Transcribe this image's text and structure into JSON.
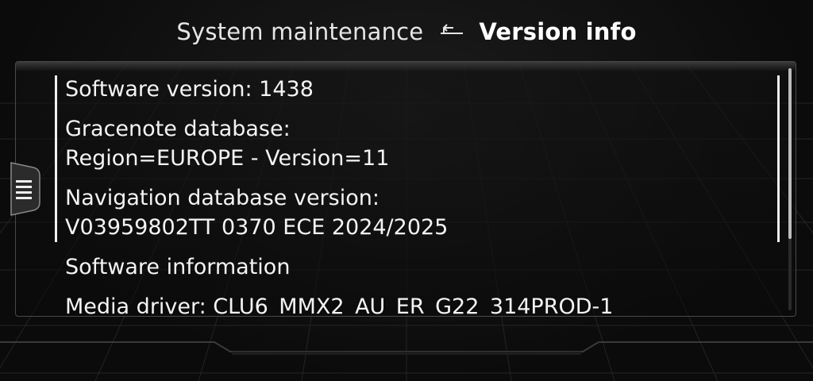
{
  "header": {
    "parent": "System maintenance",
    "current": "Version info",
    "back_icon": "return-arrow-icon"
  },
  "items": [
    {
      "lines": [
        "Software version: 1438"
      ]
    },
    {
      "lines": [
        "Gracenote database:",
        "Region=EUROPE - Version=11"
      ]
    },
    {
      "lines": [
        "Navigation database version:",
        "V03959802TT 0370 ECE 2024/2025"
      ]
    },
    {
      "lines": [
        "Software information"
      ]
    },
    {
      "lines": [
        "Media driver: CLU6_MMX2_AU_ER_G22_314PROD-1"
      ]
    }
  ],
  "menu_icon": "hamburger-menu-icon",
  "colors": {
    "background": "#0b0b0b",
    "text": "#f4f4f4",
    "panel_border": "#4a4a4a",
    "selection": "#f0f0f0"
  }
}
